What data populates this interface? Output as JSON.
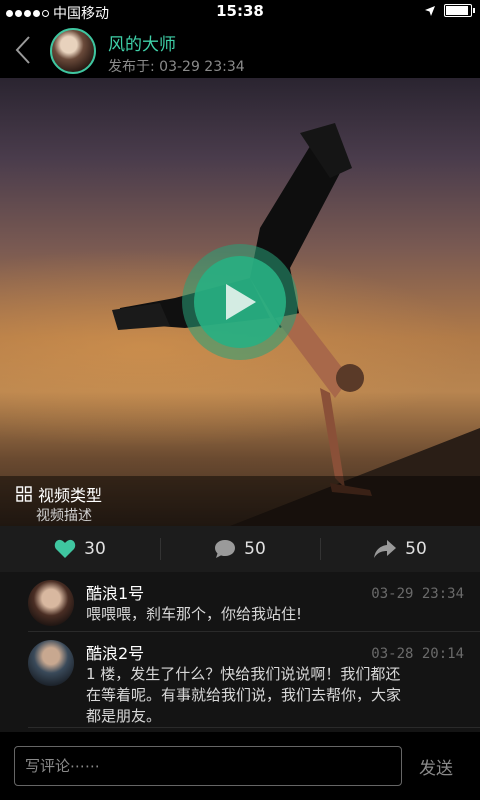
{
  "status_bar": {
    "signal_dots": 5,
    "carrier": "中国移动",
    "time": "15:38",
    "battery_level": 0.9,
    "location_icon": "location-arrow-icon"
  },
  "header": {
    "back_icon": "chevron-left-icon",
    "author": "风的大师",
    "published": "发布于: 03-29 23:34"
  },
  "video": {
    "type_label": "视频类型",
    "description": "视频描述",
    "play_icon": "play-icon",
    "accent": "#2fae86"
  },
  "actions": [
    {
      "icon": "heart-icon",
      "count": "30",
      "color": "#3fc6a0"
    },
    {
      "icon": "comment-icon",
      "count": "50",
      "color": "#9a9a9a"
    },
    {
      "icon": "share-icon",
      "count": "50",
      "color": "#9a9a9a"
    }
  ],
  "comments": [
    {
      "name": "酷浪1号",
      "time": "03-29 23:34",
      "text": "喂喂喂，刹车那个，你给我站住!"
    },
    {
      "name": "酷浪2号",
      "time": "03-28 20:14",
      "text": "1 楼，发生了什么？快给我们说说啊！我们都还在等着呢。有事就给我们说，我们去帮你，大家都是朋友。"
    }
  ],
  "input_bar": {
    "placeholder": "写评论⋯⋯",
    "send_label": "发送"
  }
}
